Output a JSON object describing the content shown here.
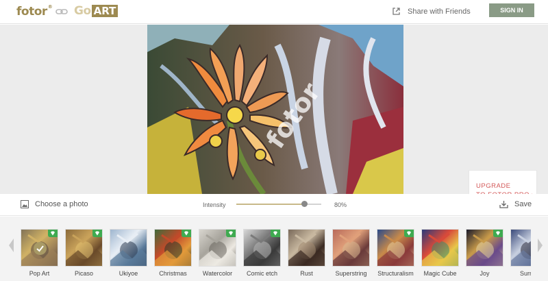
{
  "header": {
    "logo_text": "fotor",
    "logo_reg": "®",
    "go_text": "Go",
    "art_text": "ART",
    "share_label": "Share with Friends",
    "signin_label": "SIGN IN"
  },
  "canvas": {
    "watermark": "fotor",
    "upgrade_line1": "UPGRADE",
    "upgrade_line2": "TO FOTOR PRO"
  },
  "controls": {
    "choose_label": "Choose a photo",
    "intensity_label": "Intensity",
    "intensity_value": "80%",
    "intensity_fraction": 0.8,
    "save_label": "Save"
  },
  "filters": [
    {
      "label": "Pop Art",
      "pro": true,
      "selected": true
    },
    {
      "label": "Picaso",
      "pro": true,
      "selected": false
    },
    {
      "label": "Ukiyoe",
      "pro": false,
      "selected": false
    },
    {
      "label": "Christmas",
      "pro": true,
      "selected": false
    },
    {
      "label": "Watercolor",
      "pro": true,
      "selected": false
    },
    {
      "label": "Comic etch",
      "pro": true,
      "selected": false
    },
    {
      "label": "Rust",
      "pro": false,
      "selected": false
    },
    {
      "label": "Superstring",
      "pro": false,
      "selected": false
    },
    {
      "label": "Structuralism",
      "pro": true,
      "selected": false
    },
    {
      "label": "Magic Cube",
      "pro": false,
      "selected": false
    },
    {
      "label": "Joy",
      "pro": true,
      "selected": false
    },
    {
      "label": "Surrea",
      "pro": false,
      "selected": false
    }
  ],
  "colors": {
    "brand_gold": "#9d8a51",
    "signin_bg": "#8a9b86",
    "upgrade_red": "#d35858",
    "pro_badge": "#3faa50"
  }
}
